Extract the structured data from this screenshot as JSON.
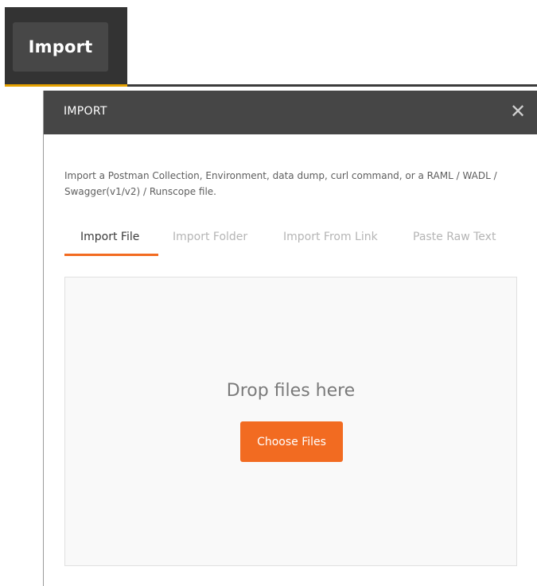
{
  "toolbar": {
    "import_label": "Import"
  },
  "modal": {
    "title": "IMPORT",
    "close_icon": "close-icon",
    "description": "Import a Postman Collection, Environment, data dump, curl command, or a RAML / WADL / Swagger(v1/v2) / Runscope file.",
    "tabs": [
      {
        "label": "Import File",
        "active": true
      },
      {
        "label": "Import Folder",
        "active": false
      },
      {
        "label": "Import From Link",
        "active": false
      },
      {
        "label": "Paste Raw Text",
        "active": false
      }
    ],
    "dropzone": {
      "text": "Drop files here",
      "button_label": "Choose Files"
    }
  },
  "colors": {
    "accent": "#f26b21",
    "header_bg": "#464646",
    "toolbar_bg": "#333333",
    "toolbar_accent": "#e6a200"
  }
}
